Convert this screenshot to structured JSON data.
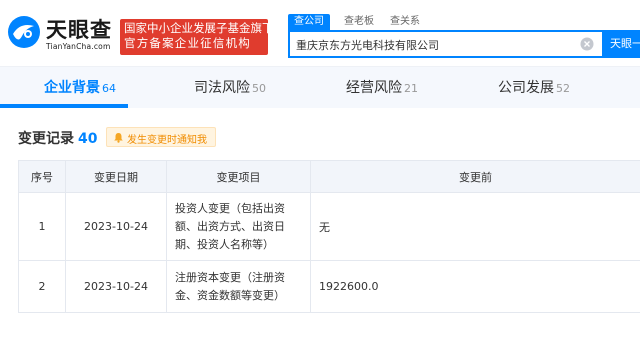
{
  "colors": {
    "accent": "#0084ff",
    "banner": "#e03c2e",
    "warning": "#f08c00"
  },
  "header": {
    "logo_cn": "天眼查",
    "logo_en": "TianYanCha.com",
    "banner_line1": "国家中小企业发展子基金旗下",
    "banner_line2": "官方备案企业征信机构",
    "search_tabs": [
      "查公司",
      "查老板",
      "查关系"
    ],
    "search_value": "重庆京东方光电科技有限公司",
    "search_button": "天眼一下",
    "icons": {
      "logo": "tianyancha-logo",
      "clear": "clear-icon"
    }
  },
  "nav": {
    "tabs": [
      {
        "label": "企业背景",
        "count": "64"
      },
      {
        "label": "司法风险",
        "count": "50"
      },
      {
        "label": "经营风险",
        "count": "21"
      },
      {
        "label": "公司发展",
        "count": "52"
      }
    ]
  },
  "section": {
    "title": "变更记录",
    "count": "40",
    "notify_label": "发生变更时通知我"
  },
  "table": {
    "headers": [
      "序号",
      "变更日期",
      "变更项目",
      "变更前"
    ],
    "rows": [
      {
        "no": "1",
        "date": "2023-10-24",
        "item": "投资人变更（包括出资额、出资方式、出资日期、投资人名称等）",
        "before": "无"
      },
      {
        "no": "2",
        "date": "2023-10-24",
        "item": "注册资本变更（注册资金、资金数额等变更）",
        "before": "1922600.0"
      }
    ]
  }
}
